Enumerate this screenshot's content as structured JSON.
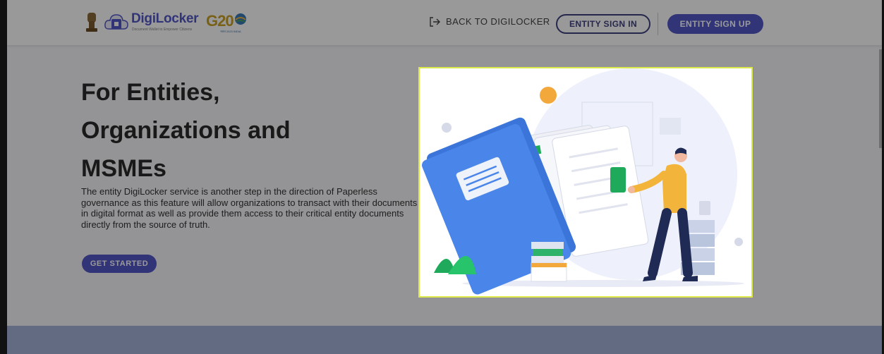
{
  "header": {
    "logo_title": "DigiLocker",
    "logo_subtitle": "Document Wallet to Empower Citizens",
    "g20_label": "G20",
    "g20_subtitle": "भारत 2023 INDIA",
    "back_label": "BACK TO DIGILOCKER",
    "sign_in_label": "ENTITY SIGN IN",
    "sign_up_label": "ENTITY SIGN UP"
  },
  "hero": {
    "title_lines": [
      "For Entities,",
      "Organizations and",
      "MSMEs"
    ],
    "description": "The entity DigiLocker service is another step in the direction of Paperless governance as this feature will allow organizations to transact with their documents in digital format as well as provide them access to their critical entity documents directly from the source of truth.",
    "cta_label": "GET STARTED",
    "illustration": "person-carrying-documents-illustration"
  },
  "colors": {
    "brand": "#5457c8",
    "outline": "#3f4180",
    "highlight_border": "#dde94a",
    "band": "#a6b3db"
  }
}
